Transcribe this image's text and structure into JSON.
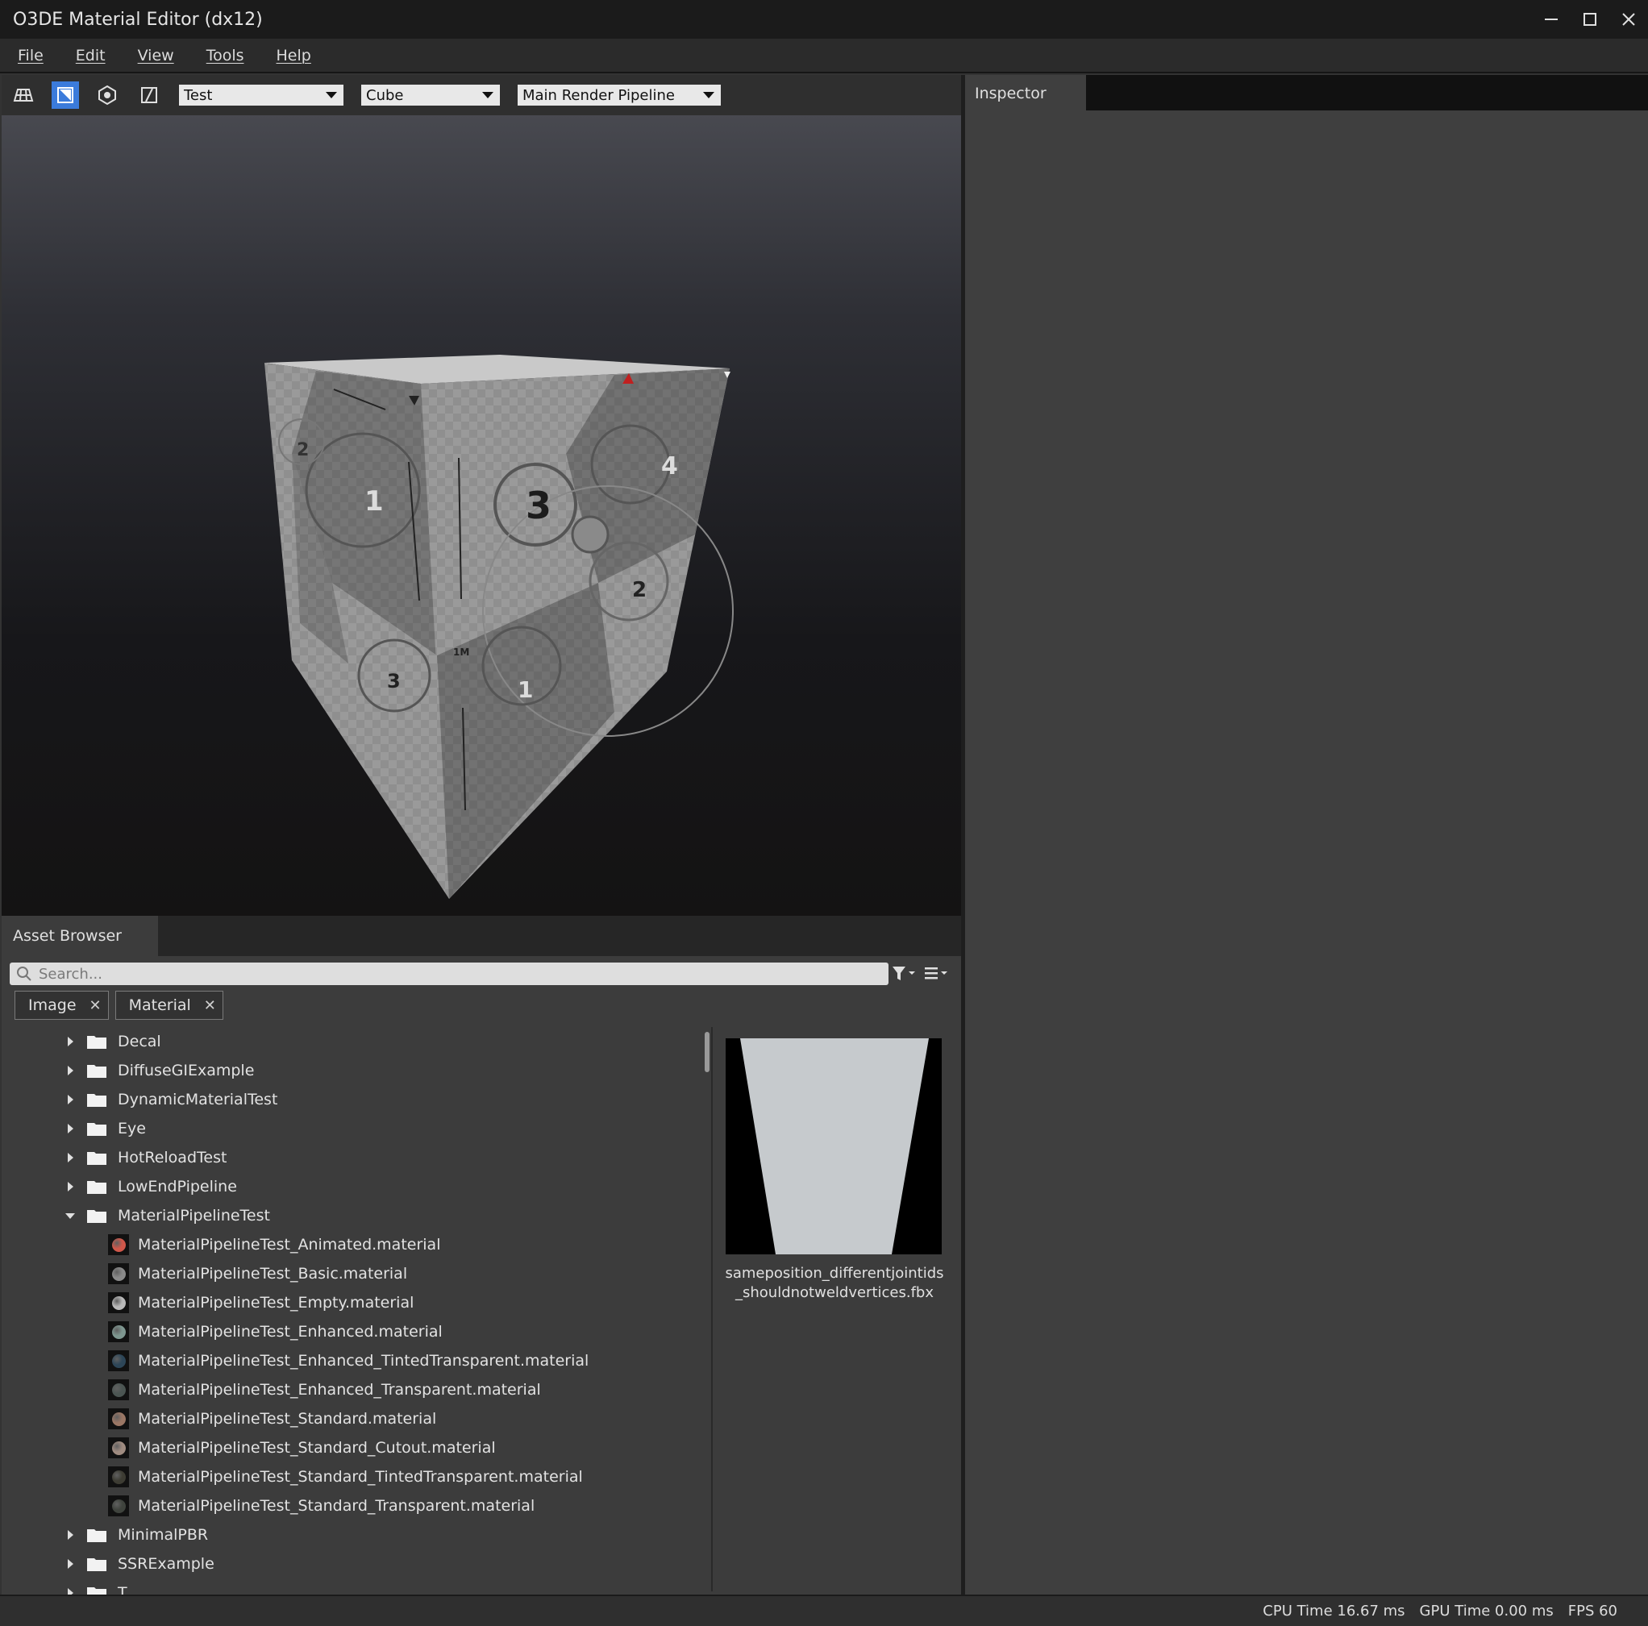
{
  "window": {
    "title": "O3DE Material Editor (dx12)"
  },
  "menu": [
    "File",
    "Edit",
    "View",
    "Tools",
    "Help"
  ],
  "toolbar": {
    "icons": [
      "grid-icon",
      "shadow-catcher-icon",
      "lighting-preset-icon",
      "tonemapping-icon"
    ],
    "lighting_preset": "Test",
    "model_preset": "Cube",
    "render_pipeline": "Main Render Pipeline"
  },
  "viewport": {
    "cube_face_numbers": [
      "3",
      "4",
      "2",
      "1",
      "1",
      "2",
      "3"
    ],
    "cube_labels": [
      "1M"
    ]
  },
  "asset_browser": {
    "tab_label": "Asset Browser",
    "search_placeholder": "Search...",
    "filter_chips": [
      "Image",
      "Material"
    ],
    "tree": [
      {
        "type": "folder",
        "label": "Decal",
        "expanded": false
      },
      {
        "type": "folder",
        "label": "DiffuseGIExample",
        "expanded": false
      },
      {
        "type": "folder",
        "label": "DynamicMaterialTest",
        "expanded": false
      },
      {
        "type": "folder",
        "label": "Eye",
        "expanded": false
      },
      {
        "type": "folder",
        "label": "HotReloadTest",
        "expanded": false
      },
      {
        "type": "folder",
        "label": "LowEndPipeline",
        "expanded": false
      },
      {
        "type": "folder",
        "label": "MaterialPipelineTest",
        "expanded": true
      },
      {
        "type": "file",
        "label": "MaterialPipelineTest_Animated.material",
        "color": "#d0574a"
      },
      {
        "type": "file",
        "label": "MaterialPipelineTest_Basic.material",
        "color": "#8a8a8a"
      },
      {
        "type": "file",
        "label": "MaterialPipelineTest_Empty.material",
        "color": "#b9b9b9"
      },
      {
        "type": "file",
        "label": "MaterialPipelineTest_Enhanced.material",
        "color": "#7e9790"
      },
      {
        "type": "file",
        "label": "MaterialPipelineTest_Enhanced_TintedTransparent.material",
        "color": "#2d4658"
      },
      {
        "type": "file",
        "label": "MaterialPipelineTest_Enhanced_Transparent.material",
        "color": "#4b5552"
      },
      {
        "type": "file",
        "label": "MaterialPipelineTest_Standard.material",
        "color": "#9a7664"
      },
      {
        "type": "file",
        "label": "MaterialPipelineTest_Standard_Cutout.material",
        "color": "#9f8b80"
      },
      {
        "type": "file",
        "label": "MaterialPipelineTest_Standard_TintedTransparent.material",
        "color": "#3d3c33"
      },
      {
        "type": "file",
        "label": "MaterialPipelineTest_Standard_Transparent.material",
        "color": "#3f433d"
      },
      {
        "type": "folder",
        "label": "MinimalPBR",
        "expanded": false
      },
      {
        "type": "folder",
        "label": "SSRExample",
        "expanded": false
      },
      {
        "type": "folder",
        "label": "T...",
        "expanded": false
      }
    ],
    "preview_filename": [
      "sameposition_differentjointids",
      "_shouldnotweldvertices.fbx"
    ]
  },
  "inspector": {
    "tab_label": "Inspector"
  },
  "status": {
    "cpu": "CPU Time 16.67 ms",
    "gpu": "GPU Time 0.00 ms",
    "fps": "FPS 60"
  },
  "colors": {
    "accent": "#3b7bdb",
    "titlebar": "#1b1b1b",
    "panel": "#3c3c3c"
  }
}
